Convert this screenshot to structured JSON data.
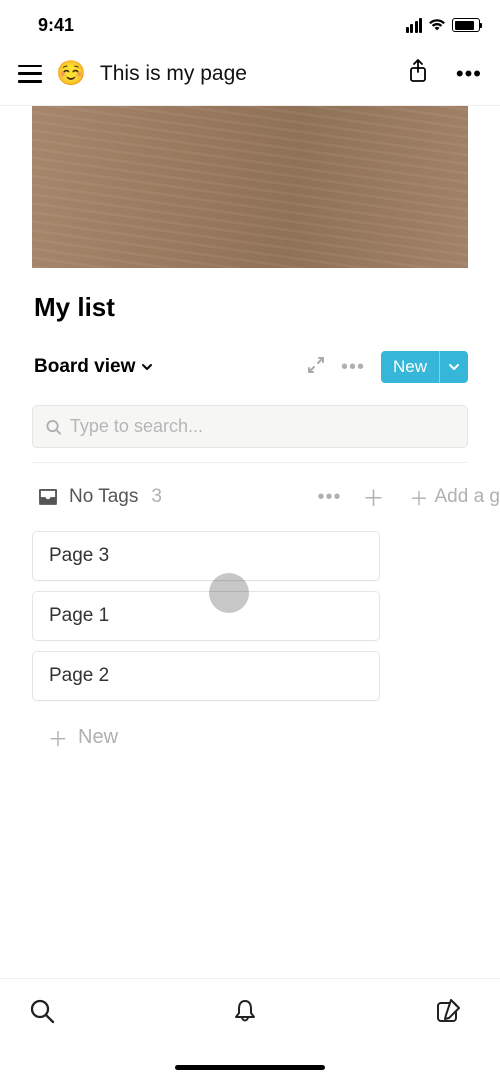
{
  "status": {
    "time": "9:41"
  },
  "header": {
    "emoji": "☺️",
    "title": "This is my page"
  },
  "list": {
    "title": "My list",
    "view": "Board view",
    "new_label": "New",
    "search_placeholder": "Type to search..."
  },
  "group": {
    "name": "No Tags",
    "count": "3",
    "add_group_label": "Add a g"
  },
  "cards": [
    {
      "title": "Page 3"
    },
    {
      "title": "Page 1"
    },
    {
      "title": "Page 2"
    }
  ],
  "new_card_label": "New"
}
